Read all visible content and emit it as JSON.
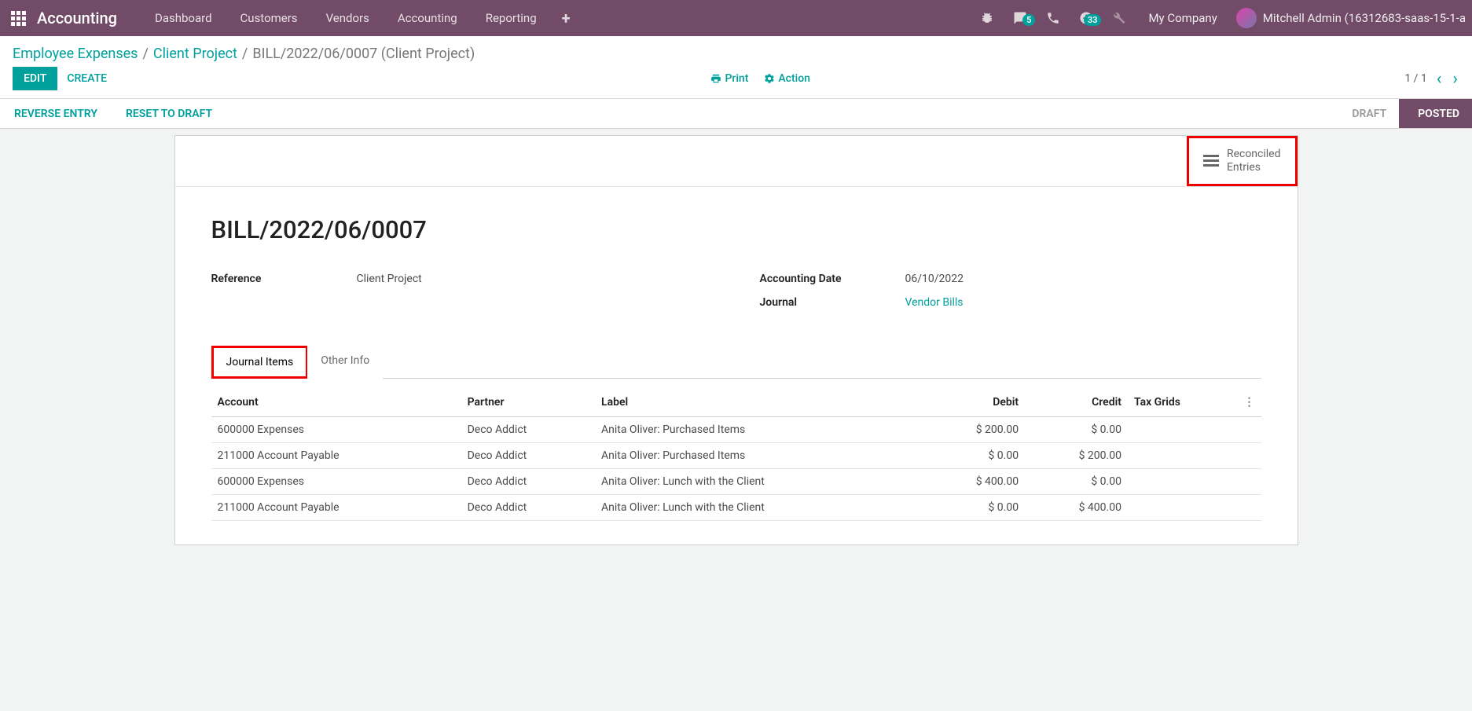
{
  "navbar": {
    "app_name": "Accounting",
    "menu": [
      "Dashboard",
      "Customers",
      "Vendors",
      "Accounting",
      "Reporting"
    ],
    "badges": {
      "messaging": "5",
      "activities": "33"
    },
    "company": "My Company",
    "user": "Mitchell Admin (16312683-saas-15-1-a"
  },
  "breadcrumb": {
    "parent1": "Employee Expenses",
    "parent2": "Client Project",
    "current": "BILL/2022/06/0007 (Client Project)"
  },
  "buttons": {
    "edit": "EDIT",
    "create": "CREATE",
    "print": "Print",
    "action": "Action",
    "reverse": "REVERSE ENTRY",
    "reset": "RESET TO DRAFT"
  },
  "pager": {
    "value": "1 / 1"
  },
  "status": {
    "draft": "DRAFT",
    "posted": "POSTED"
  },
  "stat_button": {
    "line1": "Reconciled",
    "line2": "Entries"
  },
  "record": {
    "title": "BILL/2022/06/0007",
    "reference_label": "Reference",
    "reference_value": "Client Project",
    "date_label": "Accounting Date",
    "date_value": "06/10/2022",
    "journal_label": "Journal",
    "journal_value": "Vendor Bills"
  },
  "tabs": {
    "journal_items": "Journal Items",
    "other_info": "Other Info"
  },
  "table": {
    "headers": {
      "account": "Account",
      "partner": "Partner",
      "label": "Label",
      "debit": "Debit",
      "credit": "Credit",
      "tax_grids": "Tax Grids"
    },
    "rows": [
      {
        "account": "600000 Expenses",
        "partner": "Deco Addict",
        "label": "Anita Oliver: Purchased Items",
        "debit": "$ 200.00",
        "credit": "$ 0.00",
        "tax_grids": ""
      },
      {
        "account": "211000 Account Payable",
        "partner": "Deco Addict",
        "label": "Anita Oliver: Purchased Items",
        "debit": "$ 0.00",
        "credit": "$ 200.00",
        "tax_grids": ""
      },
      {
        "account": "600000 Expenses",
        "partner": "Deco Addict",
        "label": "Anita Oliver: Lunch with the Client",
        "debit": "$ 400.00",
        "credit": "$ 0.00",
        "tax_grids": ""
      },
      {
        "account": "211000 Account Payable",
        "partner": "Deco Addict",
        "label": "Anita Oliver: Lunch with the Client",
        "debit": "$ 0.00",
        "credit": "$ 400.00",
        "tax_grids": ""
      }
    ]
  }
}
